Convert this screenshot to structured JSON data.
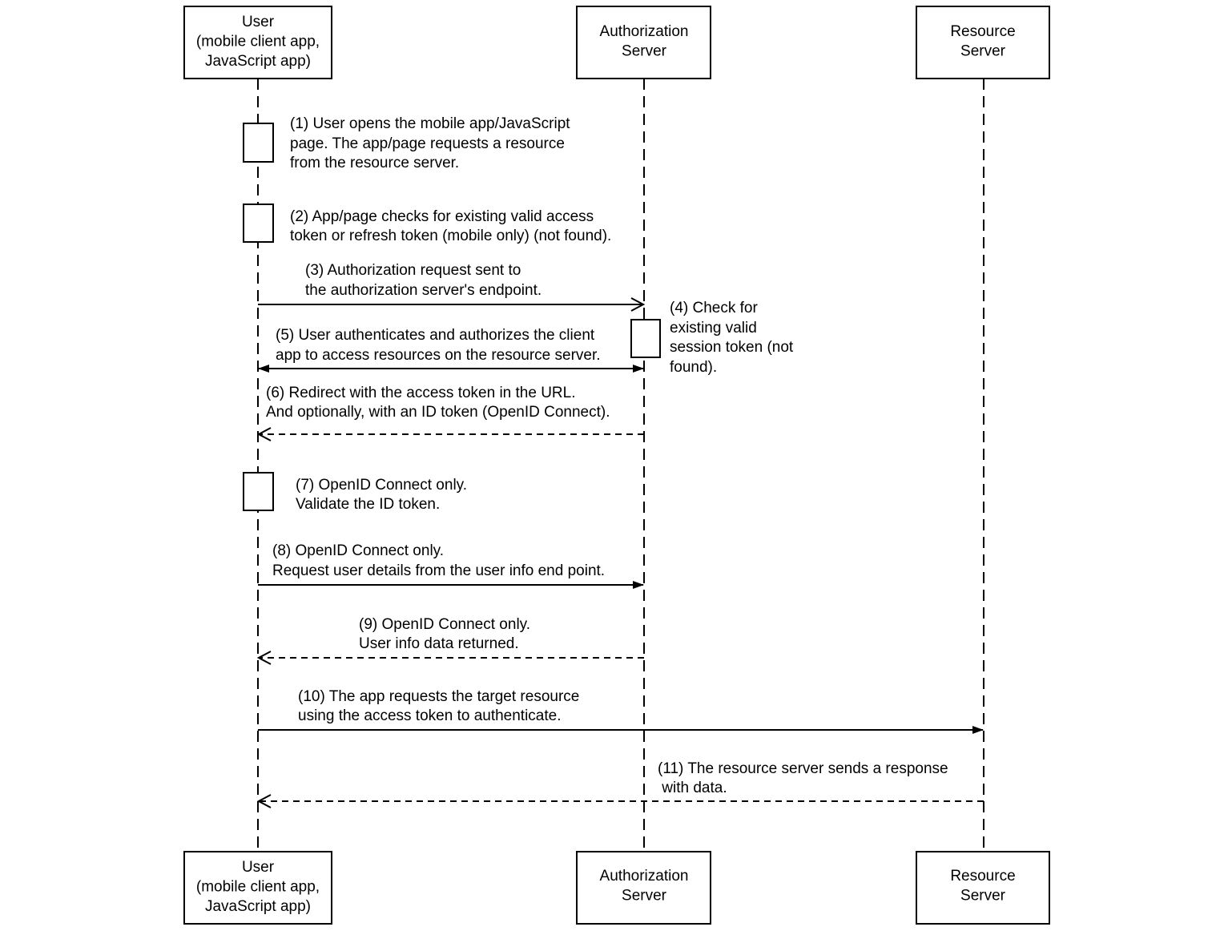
{
  "participants": [
    {
      "id": "user",
      "lines": [
        "User",
        "(mobile client app,",
        "JavaScript app)"
      ]
    },
    {
      "id": "auth",
      "lines": [
        "Authorization",
        "Server"
      ]
    },
    {
      "id": "resource",
      "lines": [
        "Resource",
        "Server"
      ]
    }
  ],
  "steps": [
    {
      "lines": [
        "(1) User opens the mobile app/JavaScript",
        "page. The app/page requests a resource",
        "from the resource server."
      ]
    },
    {
      "lines": [
        "(2) App/page checks for existing valid access",
        "token or refresh token (mobile only) (not found)."
      ]
    },
    {
      "lines": [
        "(3) Authorization request sent to",
        "the authorization server's endpoint."
      ]
    },
    {
      "lines": [
        "(4) Check for",
        "existing valid",
        "session token (not",
        "found)."
      ]
    },
    {
      "lines": [
        "(5) User authenticates and authorizes the client",
        "app to access resources on the resource server."
      ]
    },
    {
      "lines": [
        "(6) Redirect with the access token in the URL.",
        "And optionally, with an ID token (OpenID Connect)."
      ]
    },
    {
      "lines": [
        "(7) OpenID Connect only.",
        "Validate the ID token."
      ]
    },
    {
      "lines": [
        "(8) OpenID Connect only.",
        "Request user details from the user info end point."
      ]
    },
    {
      "lines": [
        "(9) OpenID Connect only.",
        "User info data returned."
      ]
    },
    {
      "lines": [
        "(10) The app requests the target resource",
        "using the access token to authenticate."
      ]
    },
    {
      "lines": [
        "(11) The resource server sends a response",
        " with data."
      ]
    }
  ]
}
